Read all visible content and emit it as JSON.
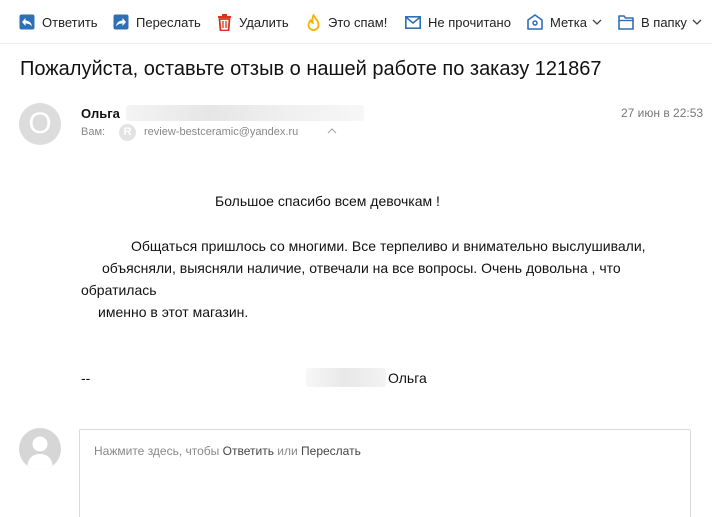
{
  "toolbar": {
    "reply": "Ответить",
    "forward": "Переслать",
    "delete": "Удалить",
    "spam": "Это спам!",
    "unread": "Не прочитано",
    "label": "Метка",
    "folder": "В папку"
  },
  "message": {
    "subject": "Пожалуйста, оставьте отзыв о нашей работе по заказу 121867",
    "sender": {
      "avatar_letter": "О",
      "name": "Ольга"
    },
    "date": "27 июн в 22:53",
    "to": {
      "label": "Вам:",
      "avatar_letter": "R",
      "email": "review-bestceramic@yandex.ru"
    },
    "body": {
      "line1": "Большое спасибо всем девочкам !",
      "line2": "Общаться пришлось со многими. Все терпеливо и внимательно  выслушивали,",
      "line3": "объясняли, выясняли наличие, отвечали на все вопросы. Очень довольна , что",
      "line4": "обратилась",
      "line5": "именно в этот магазин.",
      "sig_dash": "--",
      "sig_name": "Ольга"
    }
  },
  "reply_box": {
    "prefix": "Нажмите здесь, чтобы ",
    "reply_link": "Ответить",
    "middle": " или ",
    "forward_link": "Переслать"
  },
  "colors": {
    "accent_blue": "#2f6fb6",
    "delete_red": "#e0301e",
    "spam_yellow": "#f5b400"
  }
}
